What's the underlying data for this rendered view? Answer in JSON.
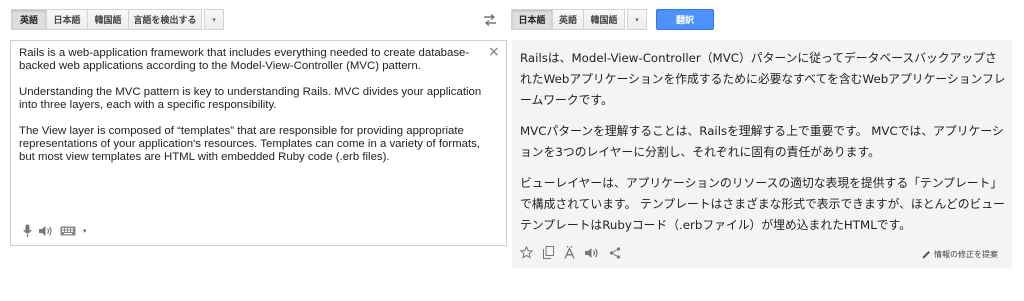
{
  "source_langs": {
    "items": [
      "英語",
      "日本語",
      "韓国語",
      "言語を検出する"
    ],
    "dropdown_caret": "▾"
  },
  "target_langs": {
    "items": [
      "日本語",
      "英語",
      "韓国語"
    ],
    "dropdown_caret": "▾"
  },
  "translate_button": "翻訳",
  "source": {
    "paragraphs": [
      "Rails is a web-application framework that includes everything needed to create database-backed web applications according to the Model-View-Controller (MVC) pattern.",
      "Understanding the MVC pattern is key to understanding Rails. MVC divides your application into three layers, each with a specific responsibility.",
      "The View layer is composed of “templates” that are responsible for providing appropriate representations of your application's resources. Templates can come in a variety of formats, but most view templates are HTML with embedded Ruby code (.erb files)."
    ],
    "clear_glyph": "×"
  },
  "target": {
    "paragraphs": [
      "Railsは、Model-View-Controller（MVC）パターンに従ってデータベースバックアップされたWebアプリケーションを作成するために必要なすべてを含むWebアプリケーションフレームワークです。",
      "MVCパターンを理解することは、Railsを理解する上で重要です。 MVCでは、アプリケーションを3つのレイヤーに分割し、それぞれに固有の責任があります。",
      "ビューレイヤーは、アプリケーションのリソースの適切な表現を提供する「テンプレート」で構成されています。 テンプレートはさまざまな形式で表示できますが、ほとんどのビューテンプレートはRubyコード（.erbファイル）が埋め込まれたHTMLです。"
    ],
    "suggest_edit": "情報の修正を提案"
  },
  "icons": {
    "mic": "mic-icon",
    "speaker": "speaker-icon",
    "keyboard": "keyboard-icon",
    "swap": "swap-languages-icon",
    "star": "star-icon",
    "copy": "copy-icon",
    "phonetic": "phonetic-icon",
    "share": "share-icon",
    "pencil": "pencil-icon"
  },
  "colors": {
    "translate_button": "#4d90fe",
    "target_background": "#f4f4f4",
    "icon_gray": "#888888"
  }
}
